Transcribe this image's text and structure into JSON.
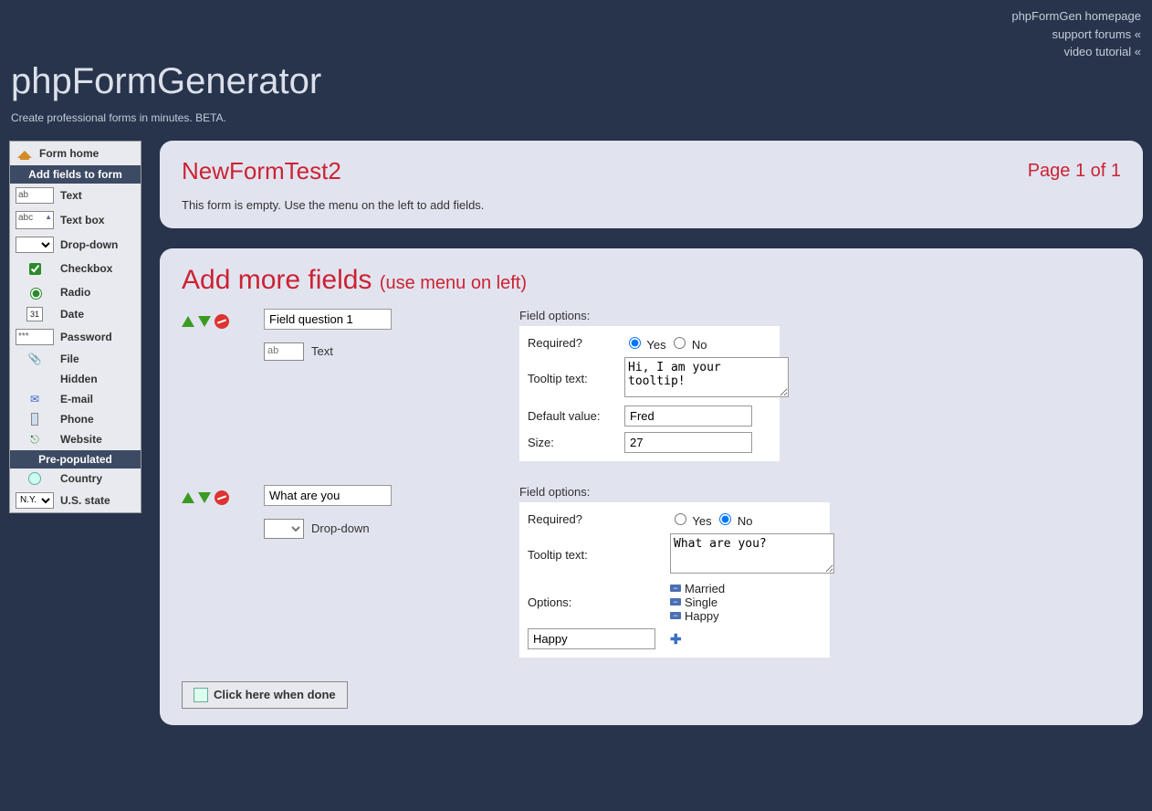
{
  "topLinks": {
    "homepage": "phpFormGen homepage",
    "forums": "support forums «",
    "tutorial": "video tutorial «"
  },
  "header": {
    "title": "phpFormGenerator",
    "subtitle": "Create professional forms in minutes. BETA."
  },
  "sidebar": {
    "formHome": "Form home",
    "addHeader": "Add fields to form",
    "items": [
      {
        "sample": "ab",
        "label": "Text",
        "sampleKind": "input"
      },
      {
        "sample": "abc",
        "label": "Text box",
        "sampleKind": "textarea"
      },
      {
        "sample": "",
        "label": "Drop-down",
        "sampleKind": "select"
      },
      {
        "sample": "",
        "label": "Checkbox",
        "sampleKind": "checkbox"
      },
      {
        "sample": "",
        "label": "Radio",
        "sampleKind": "radio"
      },
      {
        "sample": "31",
        "label": "Date",
        "sampleKind": "date"
      },
      {
        "sample": "***",
        "label": "Password",
        "sampleKind": "input"
      },
      {
        "sample": "",
        "label": "File",
        "sampleKind": "file"
      },
      {
        "sample": "",
        "label": "Hidden",
        "sampleKind": "hidden"
      },
      {
        "sample": "",
        "label": "E-mail",
        "sampleKind": "email"
      },
      {
        "sample": "",
        "label": "Phone",
        "sampleKind": "phone"
      },
      {
        "sample": "",
        "label": "Website",
        "sampleKind": "website"
      }
    ],
    "prepopHeader": "Pre-populated",
    "prepop": [
      {
        "sample": "",
        "label": "Country",
        "sampleKind": "globe"
      },
      {
        "sample": "N.Y.",
        "label": "U.S. state",
        "sampleKind": "select"
      }
    ]
  },
  "formPanel": {
    "title": "NewFormTest2",
    "pageInfo": "Page 1 of 1",
    "emptyMsg": "This form is empty. Use the menu on the left to add fields."
  },
  "addPanel": {
    "title": "Add more fields",
    "note": "(use menu on left)",
    "labels": {
      "fieldOptions": "Field options:",
      "required": "Required?",
      "yes": "Yes",
      "no": "No",
      "tooltip": "Tooltip text:",
      "default": "Default value:",
      "size": "Size:",
      "options": "Options:"
    },
    "fields": [
      {
        "question": "Field question 1",
        "typeSample": "ab",
        "typeLabel": "Text",
        "requiredYes": true,
        "tooltip": "Hi, I am your tooltip!",
        "default": "Fred",
        "size": "27"
      },
      {
        "question": "What are you",
        "typeSample": "",
        "typeLabel": "Drop-down",
        "requiredYes": false,
        "tooltip": "What are you?",
        "options": [
          "Married",
          "Single",
          "Happy"
        ],
        "newOption": "Happy"
      }
    ],
    "doneLabel": "Click here when done"
  }
}
